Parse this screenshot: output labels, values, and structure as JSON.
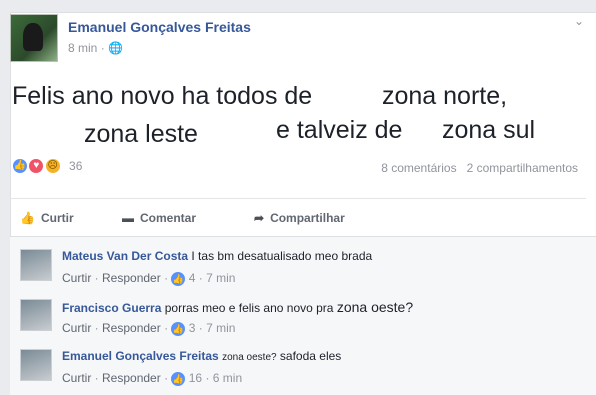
{
  "post": {
    "author": "Emanuel Gonçalves Freitas",
    "time": "8 min",
    "privacy_icon": "globe-icon",
    "text_segments": [
      "Felis ano novo ha todos de",
      "zona norte,",
      "zona leste",
      "e talveiz de",
      "zona sul"
    ]
  },
  "reactions": {
    "icons": [
      "like-icon",
      "love-icon",
      "sad-icon"
    ],
    "count": "36",
    "comments": "8 comentários",
    "shares": "2 compartilhamentos"
  },
  "actions": {
    "like": "Curtir",
    "comment": "Comentar",
    "share": "Compartilhar"
  },
  "comments": [
    {
      "name": "Mateus Van Der Costa",
      "text": "I tas bm desatualisado meo brada",
      "like": "Curtir",
      "reply": "Responder",
      "reactions": "4",
      "time": "7 min"
    },
    {
      "name": "Francisco Guerra",
      "text": "porras meo e felis ano novo pra",
      "text_extra": "zona oeste?",
      "like": "Curtir",
      "reply": "Responder",
      "reactions": "3",
      "time": "7 min"
    },
    {
      "name": "Emanuel Gonçalves Freitas",
      "text_small": "zona oeste?",
      "text": "safoda eles",
      "like": "Curtir",
      "reply": "Responder",
      "reactions": "16",
      "time": "6 min"
    }
  ],
  "colors": {
    "link": "#365899",
    "secondary": "#90949c",
    "like_blue": "#5890ff",
    "love_red": "#f25268",
    "sad_yellow": "#f7b125",
    "background": "#e9ebee"
  }
}
